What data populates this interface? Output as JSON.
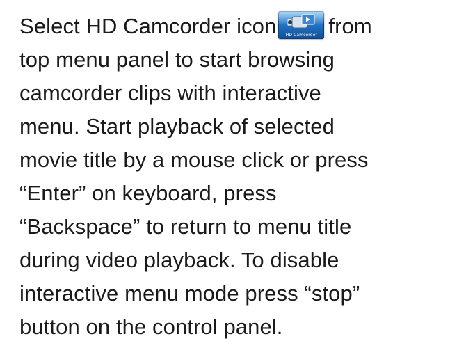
{
  "instruction": {
    "line1_before": "Select HD Camcorder icon",
    "line1_after": "from",
    "line2": "top menu panel to start browsing",
    "line3": "camcorder clips with interactive",
    "line4": "menu. Start playback of selected",
    "line5": "movie title by a mouse click or press",
    "line6": "“Enter” on keyboard, press",
    "line7": "“Backspace” to return to menu title",
    "line8": "during video playback. To disable",
    "line9": "interactive menu mode press “stop”",
    "line10": "button on the control panel."
  },
  "icon": {
    "name": "hd-camcorder-icon",
    "caption": "HD Camcorder",
    "color": "#1f6fc0"
  }
}
